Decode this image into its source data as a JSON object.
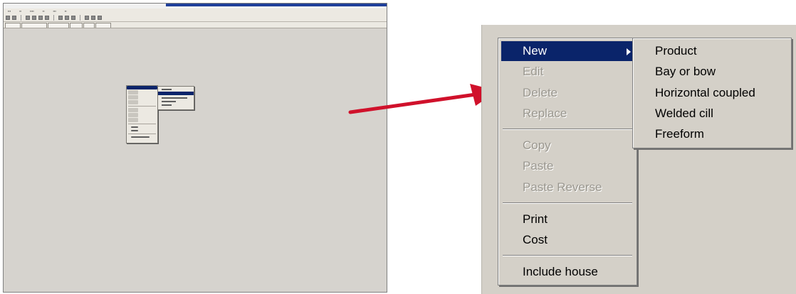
{
  "context_menu": {
    "items": [
      {
        "label": "New",
        "state": "highlighted",
        "has_submenu": true
      },
      {
        "label": "Edit",
        "state": "disabled"
      },
      {
        "label": "Delete",
        "state": "disabled"
      },
      {
        "label": "Replace",
        "state": "disabled"
      },
      {
        "label": "Copy",
        "state": "disabled"
      },
      {
        "label": "Paste",
        "state": "disabled"
      },
      {
        "label": "Paste Reverse",
        "state": "disabled"
      },
      {
        "label": "Print",
        "state": "enabled"
      },
      {
        "label": "Cost",
        "state": "enabled"
      },
      {
        "label": "Include house",
        "state": "enabled"
      }
    ]
  },
  "new_submenu": {
    "items": [
      {
        "label": "Product"
      },
      {
        "label": "Bay or bow"
      },
      {
        "label": "Horizontal coupled"
      },
      {
        "label": "Welded cill"
      },
      {
        "label": "Freeform"
      }
    ]
  },
  "colors": {
    "menu_bg": "#d4d0c8",
    "highlight": "#0a246a",
    "disabled_text": "#9a978f",
    "arrow": "#d0112b",
    "window_bg": "#d6d3ce"
  },
  "icons": {
    "arrow": "red-pointer-arrow-icon",
    "submenu_caret": "triangle-right-icon"
  }
}
